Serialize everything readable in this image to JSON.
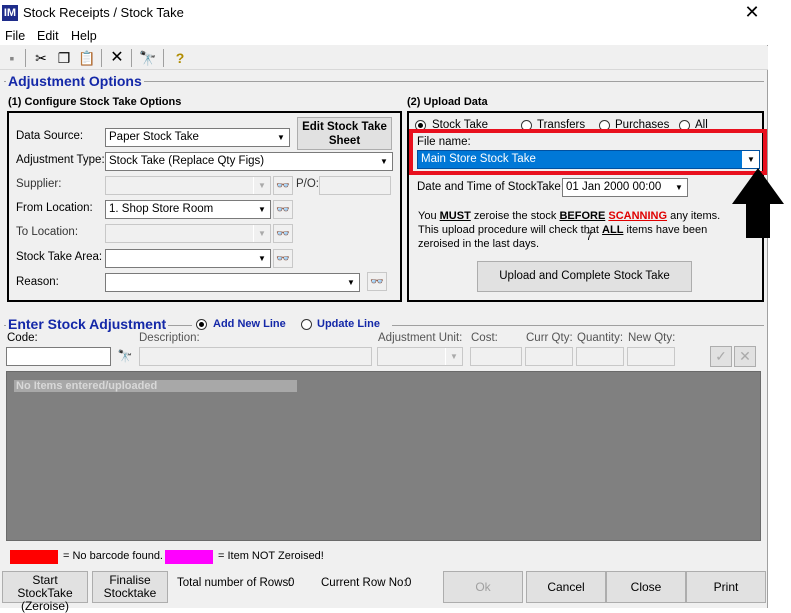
{
  "window": {
    "title": "Stock Receipts / Stock Take",
    "app_icon": "IM"
  },
  "menu": [
    "File",
    "Edit",
    "Help"
  ],
  "toolbar": {
    "icons": [
      "save-icon",
      "cut-icon",
      "copy-icon",
      "paste-icon",
      "delete-icon",
      "binoculars-icon",
      "help-icon"
    ]
  },
  "adjustment": {
    "group_title": "Adjustment Options",
    "section1_title": "(1) Configure Stock Take Options",
    "data_source_label": "Data Source:",
    "data_source_value": "Paper Stock Take",
    "edit_sheet_label": "Edit Stock Take Sheet",
    "adjustment_type_label": "Adjustment Type:",
    "adjustment_type_value": "Stock Take (Replace Qty Figs)",
    "supplier_label": "Supplier:",
    "po_label": "P/O:",
    "from_location_label": "From Location:",
    "from_location_value": "1. Shop Store Room",
    "to_location_label": "To  Location:",
    "stock_take_area_label": "Stock Take Area:",
    "reason_label": "Reason:"
  },
  "upload": {
    "section2_title": "(2) Upload Data",
    "radio_stock_take": "Stock Take",
    "radio_transfers": "Transfers",
    "radio_purchases": "Purchases",
    "radio_all": "All",
    "file_name_label": "File name:",
    "file_name_value": "Main Store Stock Take",
    "datetime_label": "Date and Time of StockTake:",
    "datetime_value": "01 Jan  2000 00:00",
    "note_you": "You ",
    "note_must": "MUST",
    "note_mid": " zeroise the stock ",
    "note_before": "BEFORE",
    "note_scanning": "SCANNING",
    "note_end": " any items.",
    "note_line2a": "This upload procedure will check that ",
    "note_all": "ALL",
    "note_line2b": " items have been",
    "note_line3": "zeroised in the last        days.",
    "note_days_value": "7",
    "upload_button": "Upload and Complete Stock Take"
  },
  "enter": {
    "group_title": "Enter Stock Adjustment",
    "radio_add": "Add New Line",
    "radio_update": "Update Line",
    "col_code": "Code:",
    "col_description": "Description:",
    "col_adjustment_unit": "Adjustment Unit:",
    "col_cost": "Cost:",
    "col_curr_qty": "Curr Qty:",
    "col_quantity": "Quantity:",
    "col_new_qty": "New Qty:",
    "empty_message": "No Items entered/uploaded"
  },
  "legend": {
    "no_barcode": "= No barcode found.",
    "not_zeroised": "= Item NOT Zeroised!",
    "no_barcode_color": "#ff0000",
    "not_zeroised_color": "#ff00ff"
  },
  "status": {
    "start_stocktake_line1": "Start StockTake",
    "start_stocktake_line2": "(Zeroise)",
    "finalise_line1": "Finalise",
    "finalise_line2": "Stocktake",
    "total_rows_label": "Total number of Rows:",
    "total_rows_value": "0",
    "current_row_label": "Current Row No:",
    "current_row_value": "0",
    "ok": "Ok",
    "cancel": "Cancel",
    "close": "Close",
    "print": "Print"
  },
  "highlight_color": "#e8101e"
}
